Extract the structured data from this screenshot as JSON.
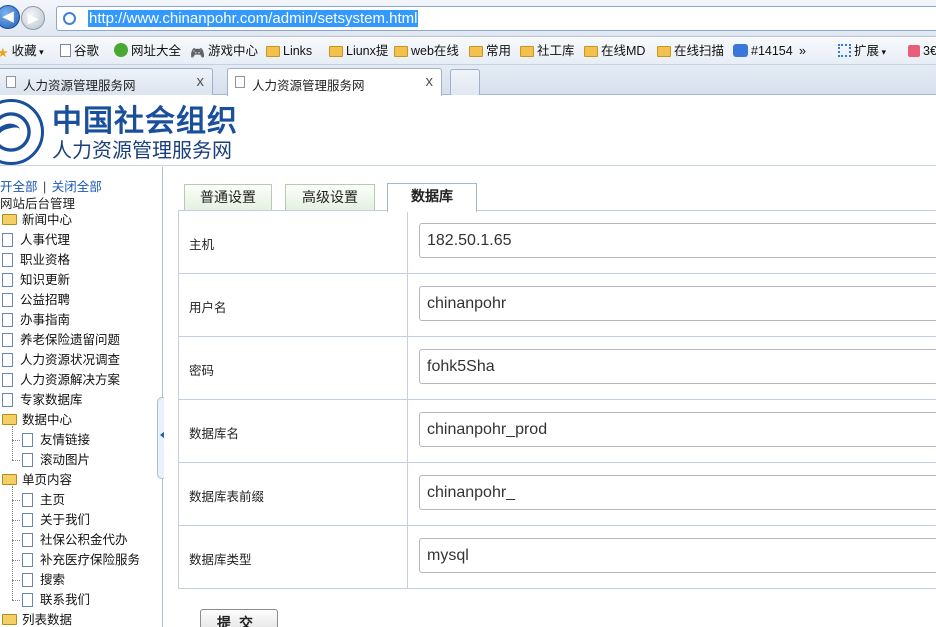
{
  "browser": {
    "url": "http://www.chinanpohr.com/admin/setsystem.html",
    "bookmarks": [
      {
        "label": "收藏",
        "icon": "star-icon"
      },
      {
        "label": "谷歌",
        "icon": "page-icon"
      },
      {
        "label": "网址大全",
        "icon": "site-nav-icon"
      },
      {
        "label": "游戏中心",
        "icon": "gamepad-icon"
      },
      {
        "label": "Links",
        "icon": "folder-icon"
      },
      {
        "label": "Liunx提",
        "icon": "folder-icon"
      },
      {
        "label": "web在线",
        "icon": "folder-icon"
      },
      {
        "label": "常用",
        "icon": "folder-icon"
      },
      {
        "label": "社工库",
        "icon": "folder-icon"
      },
      {
        "label": "在线MD",
        "icon": "folder-icon"
      },
      {
        "label": "在线扫描",
        "icon": "folder-icon"
      },
      {
        "label": "#14154",
        "icon": "cloud-icon"
      },
      {
        "label": "»",
        "icon": "more-icon"
      },
      {
        "label": "扩展",
        "icon": "apps-icon"
      },
      {
        "label": "3€",
        "icon": "extension-icon"
      }
    ],
    "tabs": [
      {
        "title": "人力资源管理服务网",
        "close": "x"
      },
      {
        "title": "人力资源管理服务网",
        "close": "x"
      }
    ]
  },
  "header": {
    "title": "中国社会组织",
    "subtitle": "人力资源管理服务网"
  },
  "sidebar": {
    "expand_all": "开全部",
    "collapse_all": "关闭全部",
    "separator": "|",
    "root": "网站后台管理",
    "items": [
      {
        "label": "新闻中心",
        "type": "folder",
        "level": 0
      },
      {
        "label": "人事代理",
        "type": "page",
        "level": 0
      },
      {
        "label": "职业资格",
        "type": "page",
        "level": 0
      },
      {
        "label": "知识更新",
        "type": "page",
        "level": 0
      },
      {
        "label": "公益招聘",
        "type": "page",
        "level": 0
      },
      {
        "label": "办事指南",
        "type": "page",
        "level": 0
      },
      {
        "label": "养老保险遗留问题",
        "type": "page",
        "level": 0
      },
      {
        "label": "人力资源状况调查",
        "type": "page",
        "level": 0
      },
      {
        "label": "人力资源解决方案",
        "type": "page",
        "level": 0
      },
      {
        "label": "专家数据库",
        "type": "page",
        "level": 0
      },
      {
        "label": "数据中心",
        "type": "folder",
        "level": 0
      },
      {
        "label": "友情链接",
        "type": "page",
        "level": 1
      },
      {
        "label": "滚动图片",
        "type": "page",
        "level": 1
      },
      {
        "label": "单页内容",
        "type": "folder",
        "level": 0
      },
      {
        "label": "主页",
        "type": "page",
        "level": 1
      },
      {
        "label": "关于我们",
        "type": "page",
        "level": 1
      },
      {
        "label": "社保公积金代办",
        "type": "page",
        "level": 1
      },
      {
        "label": "补充医疗保险服务",
        "type": "page",
        "level": 1
      },
      {
        "label": "搜索",
        "type": "page",
        "level": 1
      },
      {
        "label": "联系我们",
        "type": "page",
        "level": 1
      },
      {
        "label": "列表数据",
        "type": "folder",
        "level": 0
      }
    ]
  },
  "settings_tabs": [
    {
      "label": "普通设置",
      "active": false
    },
    {
      "label": "高级设置",
      "active": false
    },
    {
      "label": "数据库",
      "active": true
    }
  ],
  "form": {
    "fields": [
      {
        "label": "主机",
        "value": "182.50.1.65"
      },
      {
        "label": "用户名",
        "value": "chinanpohr"
      },
      {
        "label": "密码",
        "value": "fohk5Sha"
      },
      {
        "label": "数据库名",
        "value": "chinanpohr_prod"
      },
      {
        "label": "数据库表前缀",
        "value": "chinanpohr_"
      },
      {
        "label": "数据库类型",
        "value": "mysql"
      }
    ],
    "submit_label": "提交"
  }
}
